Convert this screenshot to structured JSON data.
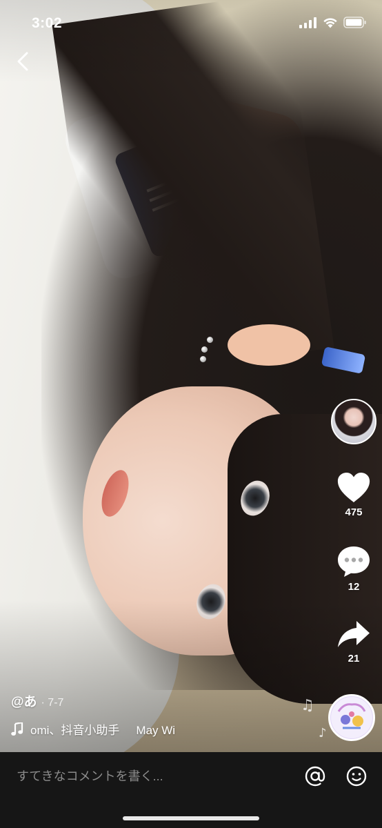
{
  "status_bar": {
    "time": "3:02",
    "signal_icon": "cellular-signal-icon",
    "wifi_icon": "wifi-icon",
    "battery_icon": "battery-icon"
  },
  "navigation": {
    "back_icon": "chevron-left-icon"
  },
  "actions": {
    "likes": "475",
    "comments": "12",
    "shares": "21",
    "like_icon": "heart-icon",
    "comment_icon": "comment-bubble-icon",
    "share_icon": "share-arrow-icon"
  },
  "caption": {
    "author": "@あ",
    "date": "· 7-7"
  },
  "sound": {
    "icon": "music-note-icon",
    "text_1": "omi、抖音小助手",
    "text_2": "May Wi"
  },
  "comment_bar": {
    "placeholder": "すてきなコメントを書く...",
    "mention_icon": "at-sign-icon",
    "emoji_icon": "emoji-face-icon"
  },
  "colors": {
    "comment_bar_bg": "#161616",
    "placeholder": "#8b8b8b",
    "icon": "#ffffff"
  }
}
